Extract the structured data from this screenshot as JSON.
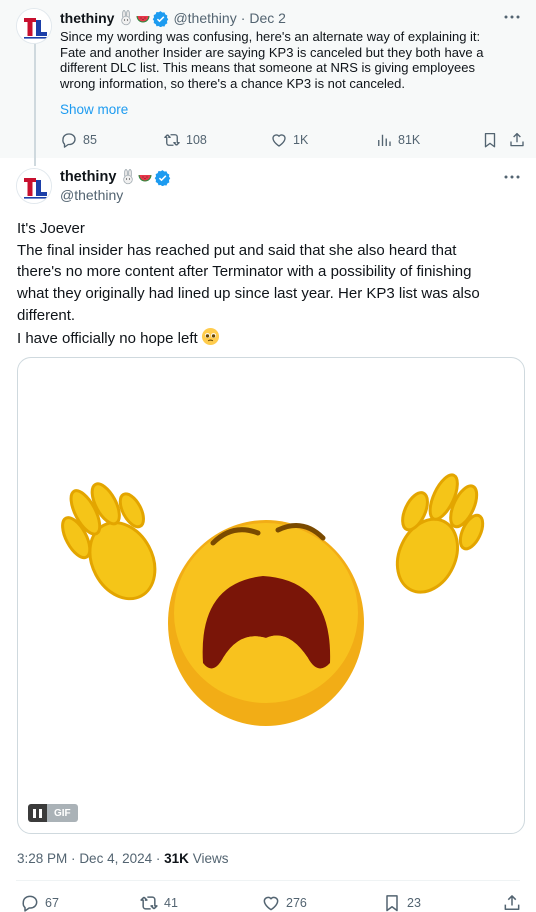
{
  "parent_tweet": {
    "author_name": "thethiny",
    "handle": "@thethiny",
    "separator": "·",
    "date": "Dec 2",
    "avatar_text": "TL",
    "text_lines": [
      "Since my wording was confusing, here's an alternate way of explaining it:",
      "Fate and another Insider are saying KP3 is canceled but they both have a",
      "different DLC list. This means that someone at NRS is giving employees",
      "wrong information, so there's a chance KP3 is not canceled."
    ],
    "show_more": "Show more",
    "stats": {
      "replies": "85",
      "reposts": "108",
      "likes": "1K",
      "views": "81K"
    },
    "icons": [
      "reply-icon",
      "repost-icon",
      "like-icon",
      "views-icon",
      "bookmark-icon",
      "share-icon"
    ]
  },
  "main_tweet": {
    "author_name": "thethiny",
    "handle": "@thethiny",
    "avatar_text": "TL",
    "text_lines": [
      "It's Joever",
      "The final insider has reached put and said that she also heard that",
      "there's no more content after Terminator with a possibility of finishing",
      "what they originally had lined up since last year. Her KP3 list was also",
      "different.",
      "I have officially no hope left"
    ],
    "media": {
      "badge": "GIF"
    },
    "time": "3:28 PM",
    "date": "Dec 4, 2024",
    "separator": "·",
    "views_count": "31K",
    "views_label": "Views",
    "stats": {
      "replies": "67",
      "reposts": "41",
      "likes": "276",
      "bookmarks": "23"
    }
  },
  "colors": {
    "accent": "#1d9bf0",
    "secondary_text": "#536471",
    "primary_text": "#0f1419",
    "parent_background": "#f7f9f9",
    "verified": "#1d9bf0",
    "avatar_red": "#c8102e",
    "avatar_blue": "#1c3fa8"
  }
}
